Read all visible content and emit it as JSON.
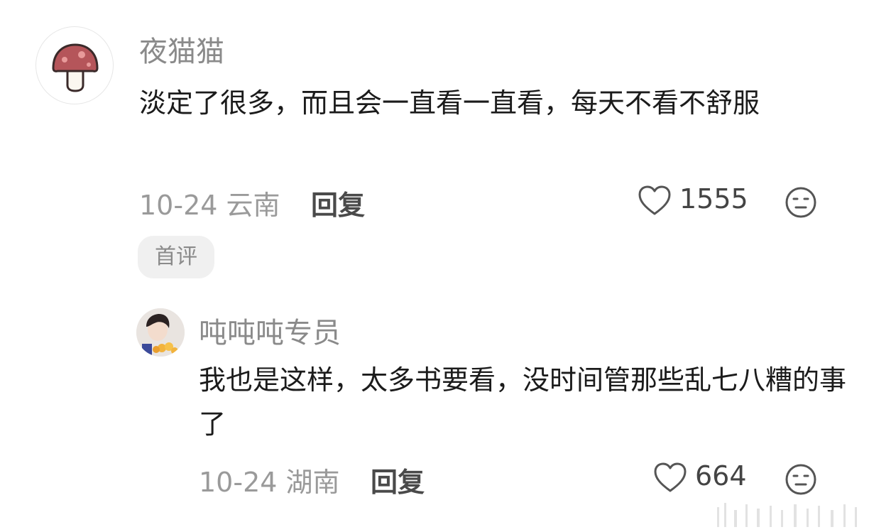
{
  "comments": [
    {
      "username": "夜猫猫",
      "avatar_icon": "mushroom-avatar",
      "content": "淡定了很多，而且会一直看一直看，每天不看不舒服",
      "date": "10-24 云南",
      "reply_label": "回复",
      "like_count": "1555",
      "badge": "首评"
    },
    {
      "username": "吨吨吨专员",
      "avatar_icon": "photo-avatar",
      "content": "我也是这样，太多书要看，没时间管那些乱七八糟的事了",
      "date": "10-24 湖南",
      "reply_label": "回复",
      "like_count": "664"
    }
  ],
  "icons": {
    "like": "heart-outline-icon",
    "reaction": "neutral-face-icon"
  },
  "colors": {
    "username": "#8a8a8a",
    "meta": "#9a9a9a",
    "badge_bg": "#f0f0f0",
    "mushroom_cap": "#b5555a"
  }
}
